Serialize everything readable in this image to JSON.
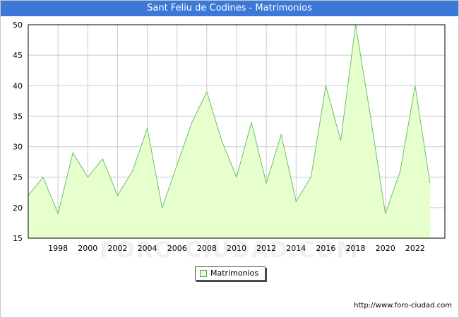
{
  "chart_data": {
    "type": "area",
    "title": "Sant Feliu de Codines - Matrimonios",
    "xlabel": "",
    "ylabel": "",
    "x": [
      1996,
      1997,
      1998,
      1999,
      2000,
      2001,
      2002,
      2003,
      2004,
      2005,
      2006,
      2007,
      2008,
      2009,
      2010,
      2011,
      2012,
      2013,
      2014,
      2015,
      2016,
      2017,
      2018,
      2019,
      2020,
      2021,
      2022,
      2023
    ],
    "series": [
      {
        "name": "Matrimonios",
        "values": [
          22,
          25,
          19,
          29,
          25,
          28,
          22,
          26,
          33,
          20,
          27,
          34,
          39,
          31,
          25,
          34,
          24,
          32,
          21,
          25,
          40,
          31,
          50,
          35,
          19,
          26,
          40,
          24
        ]
      }
    ],
    "xlim": [
      1996,
      2024
    ],
    "ylim": [
      15,
      50
    ],
    "x_ticks": [
      1998,
      2000,
      2002,
      2004,
      2006,
      2008,
      2010,
      2012,
      2014,
      2016,
      2018,
      2020,
      2022
    ],
    "y_ticks": [
      15,
      20,
      25,
      30,
      35,
      40,
      45,
      50
    ],
    "grid": true,
    "legend_position": "bottom-center",
    "colors": {
      "fill": "#e6ffcc",
      "line": "#6cbf6c",
      "grid": "#cccccc",
      "title_bar": "#3b78d8"
    }
  },
  "source_url": "http://www.foro-ciudad.com",
  "watermark": "FORO-CIUDAD.COM"
}
